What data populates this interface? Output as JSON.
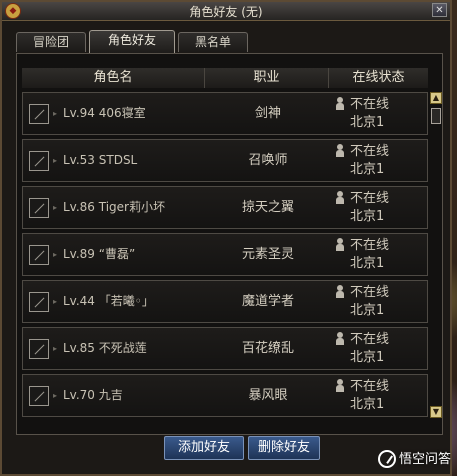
{
  "window": {
    "title": "角色好友 (无)",
    "close_glyph": "✕",
    "logo_glyph": "◆"
  },
  "tabs": [
    {
      "label": "冒险团",
      "active": false
    },
    {
      "label": "角色好友",
      "active": true
    },
    {
      "label": "黑名单",
      "active": false
    }
  ],
  "table": {
    "headers": [
      "角色名",
      "职业",
      "在线状态"
    ],
    "rows": [
      {
        "name": "Lv.94 406寝室",
        "job": "剑神",
        "status": "不在线",
        "location": "北京1"
      },
      {
        "name": "Lv.53 STDSL",
        "job": "召唤师",
        "status": "不在线",
        "location": "北京1"
      },
      {
        "name": "Lv.86 Tiger莉小坏",
        "job": "掠天之翼",
        "status": "不在线",
        "location": "北京1"
      },
      {
        "name": "Lv.89 “曹磊”",
        "job": "元素圣灵",
        "status": "不在线",
        "location": "北京1"
      },
      {
        "name": "Lv.44 「若曦◦」",
        "job": "魔道学者",
        "status": "不在线",
        "location": "北京1"
      },
      {
        "name": "Lv.85 不死战莲",
        "job": "百花缭乱",
        "status": "不在线",
        "location": "北京1"
      },
      {
        "name": "Lv.70 九吉",
        "job": "暴风眼",
        "status": "不在线",
        "location": "北京1"
      }
    ]
  },
  "scrollbar": {
    "up_glyph": "▲",
    "down_glyph": "▼"
  },
  "buttons": {
    "add_friend": "添加好友",
    "delete_friend": "删除好友"
  },
  "watermark": {
    "text": "悟空问答"
  },
  "colors": {
    "button_blue": "#2a4a7a",
    "panel_bg": "#121110",
    "border": "#5c4a34"
  }
}
